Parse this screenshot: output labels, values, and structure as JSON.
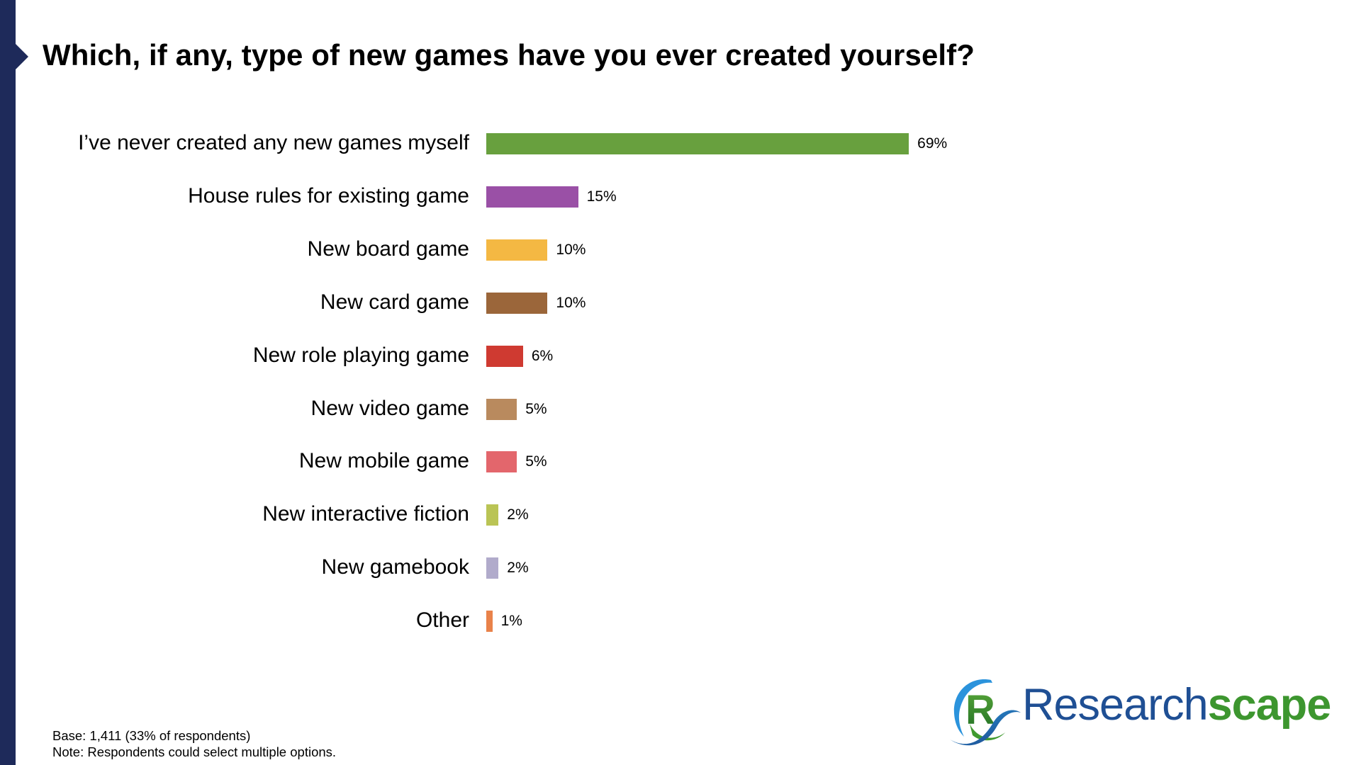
{
  "title": "Which, if any, type of new games have you ever created yourself?",
  "chart_data": {
    "type": "bar",
    "orientation": "horizontal",
    "title": "Which, if any, type of new games have you ever created yourself?",
    "xlabel": "",
    "ylabel": "",
    "xlim": [
      0,
      100
    ],
    "grid": false,
    "legend": "none",
    "categories": [
      "I’ve never created any new games myself",
      "House rules for existing game",
      "New board game",
      "New card game",
      "New role playing game",
      "New video game",
      "New mobile game",
      "New interactive fiction",
      "New gamebook",
      "Other"
    ],
    "values": [
      69,
      15,
      10,
      10,
      6,
      5,
      5,
      2,
      2,
      1
    ],
    "value_labels": [
      "69%",
      "15%",
      "10%",
      "10%",
      "6%",
      "5%",
      "5%",
      "2%",
      "2%",
      "1%"
    ],
    "colors": [
      "#68a03e",
      "#9a50a6",
      "#f4b843",
      "#9b663a",
      "#cf3a31",
      "#b98a5e",
      "#e3666c",
      "#bac455",
      "#b1abcb",
      "#e9824a"
    ],
    "unit": "%"
  },
  "footer": {
    "base": "Base: 1,411 (33% of respondents)",
    "note": "Note: Respondents could select multiple options."
  },
  "logo": {
    "part1": "Research",
    "part2": "scape"
  },
  "accent_color": "#1e2a5a"
}
